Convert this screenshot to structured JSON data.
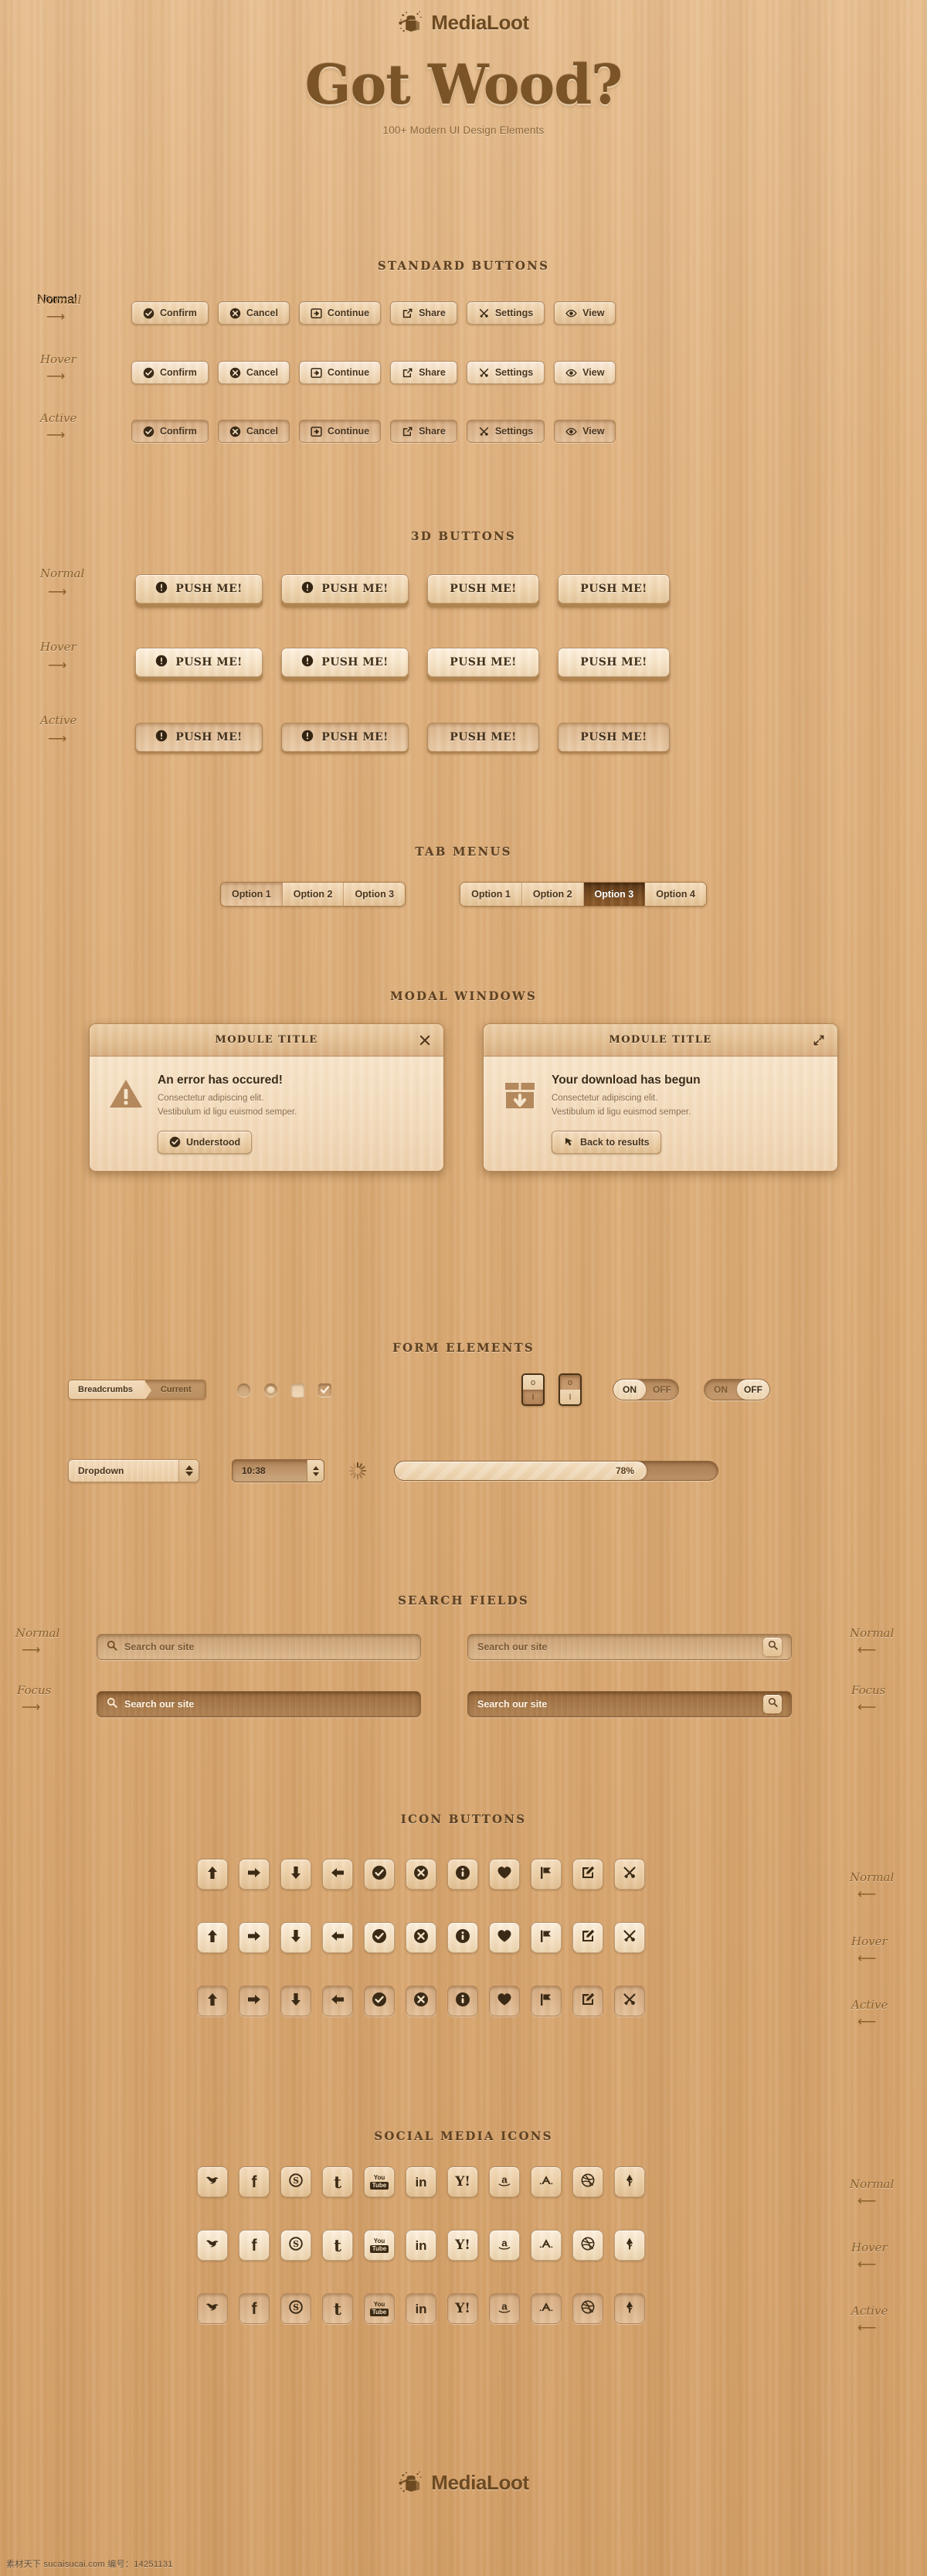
{
  "brand": {
    "name": "MediaLoot",
    "logo_icon": "mediloot-stump-icon"
  },
  "hero": {
    "title": "Got Wood?",
    "subtitle": "100+ Modern UI Design Elements"
  },
  "state_labels": {
    "normal": "Normal",
    "hover": "Hover",
    "active": "Active",
    "focus": "Focus"
  },
  "sections": {
    "standard_buttons": {
      "title": "STANDARD BUTTONS",
      "buttons": [
        {
          "label": "Confirm",
          "icon": "check-circle-icon"
        },
        {
          "label": "Cancel",
          "icon": "x-circle-icon"
        },
        {
          "label": "Continue",
          "icon": "arrow-right-box-icon"
        },
        {
          "label": "Share",
          "icon": "share-external-icon"
        },
        {
          "label": "Settings",
          "icon": "tools-cross-icon"
        },
        {
          "label": "View",
          "icon": "eye-icon"
        }
      ],
      "states": [
        "Normal",
        "Hover",
        "Active"
      ]
    },
    "buttons_3d": {
      "title": "3D BUTTONS",
      "buttons": [
        {
          "label": "PUSH ME!",
          "icon": "exclamation-circle-icon"
        },
        {
          "label": "PUSH ME!",
          "icon": "exclamation-circle-icon"
        },
        {
          "label": "PUSH ME!",
          "icon": "none"
        },
        {
          "label": "PUSH ME!",
          "icon": "none"
        }
      ],
      "states": [
        "Normal",
        "Hover",
        "Active"
      ]
    },
    "tab_menus": {
      "title": "TAB MENUS",
      "group_left": {
        "tabs": [
          "Option 1",
          "Option 2",
          "Option 3"
        ],
        "pressed_index": 0
      },
      "group_right": {
        "tabs": [
          "Option 1",
          "Option 2",
          "Option 3",
          "Option 4"
        ],
        "selected_index": 2
      }
    },
    "modal_windows": {
      "title": "MODAL WINDOWS",
      "modals": [
        {
          "title": "MODULE TITLE",
          "corner_icon": "close-x-icon",
          "body_icon": "warning-triangle-icon",
          "heading": "An error has occured!",
          "text_line1": "Consectetur adipiscing elit.",
          "text_line2": "Vestibulum id ligu euismod semper.",
          "action_label": "Understood",
          "action_icon": "check-circle-icon"
        },
        {
          "title": "MODULE TITLE",
          "corner_icon": "expand-arrows-icon",
          "body_icon": "download-box-icon",
          "heading": "Your download has begun",
          "text_line1": "Consectetur adipiscing elit.",
          "text_line2": "Vestibulum id ligu euismod semper.",
          "action_label": "Back to results",
          "action_icon": "back-arrow-icon"
        }
      ]
    },
    "form_elements": {
      "title": "FORM ELEMENTS",
      "breadcrumb": {
        "label": "Breadcrumbs",
        "current": "Current"
      },
      "radio_off_name": "radio-unchecked",
      "radio_on_name": "radio-checked",
      "check_off_name": "checkbox-unchecked",
      "check_on_name": "checkbox-checked",
      "rockers": [
        {
          "name": "rocker-switch-up",
          "top_glyph": "o",
          "bottom_glyph": "I",
          "position": "up"
        },
        {
          "name": "rocker-switch-down",
          "top_glyph": "o",
          "bottom_glyph": "I",
          "position": "down"
        }
      ],
      "toggles": [
        {
          "on_label": "ON",
          "off_label": "OFF",
          "state": "on"
        },
        {
          "on_label": "ON",
          "off_label": "OFF",
          "state": "off"
        }
      ],
      "dropdown": {
        "value": "Dropdown"
      },
      "time_field": {
        "value": "10:38"
      },
      "spinner_name": "loading-spinner-icon",
      "progress": {
        "value": 78,
        "label": "78%"
      }
    },
    "search_fields": {
      "title": "SEARCH FIELDS",
      "placeholder": "Search our site",
      "variants": [
        {
          "state": "Normal",
          "button": false
        },
        {
          "state": "Normal",
          "button": true
        },
        {
          "state": "Focus",
          "button": false
        },
        {
          "state": "Focus",
          "button": true
        }
      ]
    },
    "icon_buttons": {
      "title": "ICON BUTTONS",
      "icons": [
        "arrow-up-icon",
        "arrow-right-icon",
        "arrow-down-icon",
        "arrow-left-icon",
        "check-circle-icon",
        "x-circle-icon",
        "info-circle-icon",
        "heart-icon",
        "flag-icon",
        "edit-pencil-icon",
        "tools-cross-icon"
      ],
      "states": [
        "Normal",
        "Hover",
        "Active"
      ]
    },
    "social_media_icons": {
      "title": "SOCIAL MEDIA ICONS",
      "icons": [
        {
          "name": "twitter-icon",
          "glyph": "bird"
        },
        {
          "name": "facebook-icon",
          "glyph": "f"
        },
        {
          "name": "skype-icon",
          "glyph": "S"
        },
        {
          "name": "tumblr-icon",
          "glyph": "t"
        },
        {
          "name": "youtube-icon",
          "glyph": "You|Tube"
        },
        {
          "name": "linkedin-icon",
          "glyph": "in"
        },
        {
          "name": "yahoo-icon",
          "glyph": "Y!"
        },
        {
          "name": "amazon-icon",
          "glyph": "a"
        },
        {
          "name": "appstore-icon",
          "glyph": "A"
        },
        {
          "name": "dribbble-icon",
          "glyph": "ball"
        },
        {
          "name": "forrst-icon",
          "glyph": "tree"
        }
      ],
      "states": [
        "Normal",
        "Hover",
        "Active"
      ]
    }
  },
  "watermark": "素材天下 sucaisucai.com  编号：14251131"
}
